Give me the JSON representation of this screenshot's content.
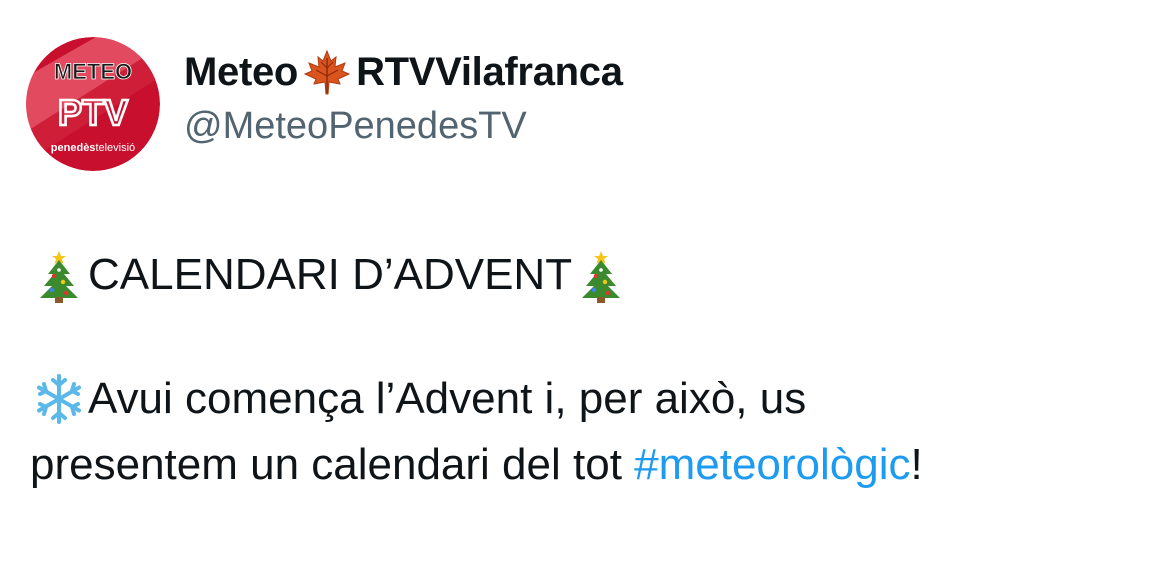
{
  "account": {
    "display_name_part1": "Meteo",
    "display_name_part2": "RTVVilafranca",
    "display_name_emoji": "maple-leaf-icon",
    "handle": "@MeteoPenedesTV",
    "avatar": {
      "top_text": "METEO",
      "logo_text": "PTV",
      "bottom_text_bold": "penedès",
      "bottom_text": "televisió",
      "colors": {
        "background": "#c8102e",
        "stripe": "#e85a6b",
        "text": "#ffffff",
        "dark": "#1a1a1a"
      }
    }
  },
  "tweet": {
    "line1_text": "CALENDARI D’ADVENT",
    "line1_emoji": "christmas-tree-icon",
    "line2_text": "Avui comença l’Advent i, per això, us",
    "line2_emoji": "snowflake-icon",
    "line3_text": "presentem un calendari del tot ",
    "hashtag": "#meteorològic",
    "line3_end": "!"
  },
  "colors": {
    "text": "#0f1419",
    "secondary": "#536471",
    "link": "#1d9bf0"
  }
}
